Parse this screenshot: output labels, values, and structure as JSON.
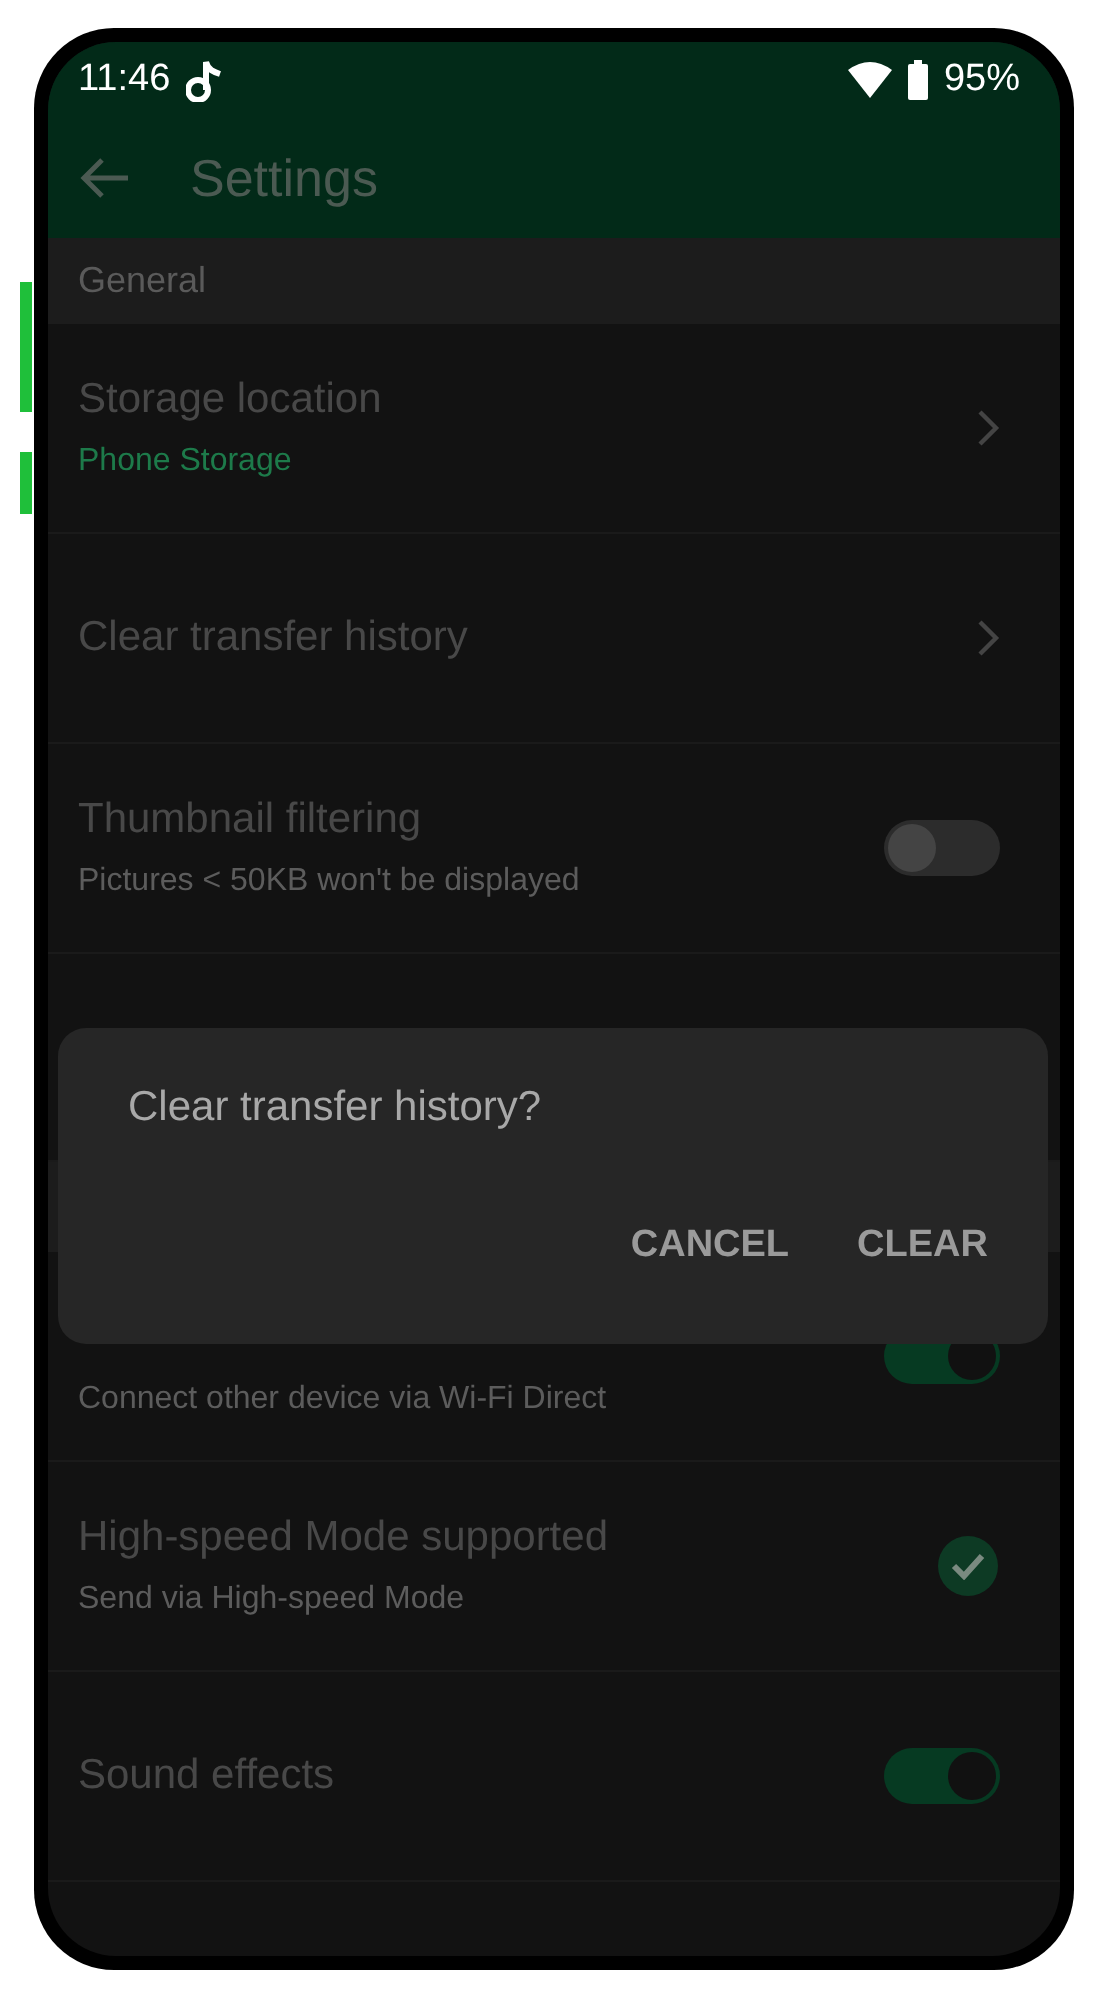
{
  "status_bar": {
    "time": "11:46",
    "battery": "95%"
  },
  "toolbar": {
    "title": "Settings"
  },
  "rows": [
    {
      "kind": "header",
      "title": "General"
    },
    {
      "kind": "nav",
      "title": "Storage location",
      "subtitle": "Phone Storage",
      "accent_subtitle": true
    },
    {
      "kind": "nav",
      "title": "Clear transfer history"
    },
    {
      "kind": "toggle",
      "title": "Thumbnail filtering",
      "subtitle": "Pictures < 50KB won't be displayed",
      "on": false
    },
    {
      "kind": "plain"
    },
    {
      "kind": "header"
    },
    {
      "kind": "toggle",
      "subtitle": "Connect other device via Wi-Fi Direct",
      "on": true
    },
    {
      "kind": "check",
      "title": "High-speed Mode supported",
      "subtitle": "Send via High-speed Mode",
      "checked": true
    },
    {
      "kind": "toggle",
      "title": "Sound effects",
      "on": true
    }
  ],
  "dialog": {
    "message": "Clear transfer history?",
    "buttons": [
      "CANCEL",
      "CLEAR"
    ]
  }
}
